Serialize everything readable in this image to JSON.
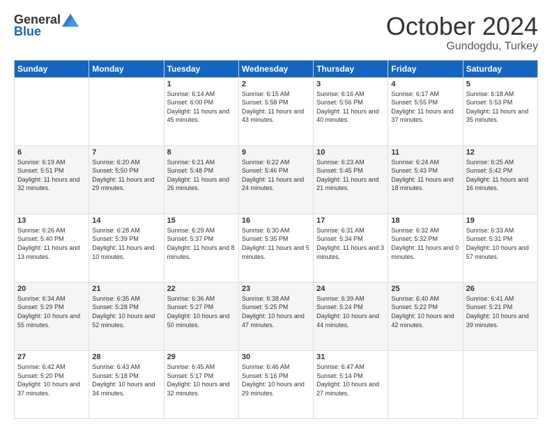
{
  "header": {
    "logo_general": "General",
    "logo_blue": "Blue",
    "month": "October 2024",
    "location": "Gundogdu, Turkey"
  },
  "weekdays": [
    "Sunday",
    "Monday",
    "Tuesday",
    "Wednesday",
    "Thursday",
    "Friday",
    "Saturday"
  ],
  "weeks": [
    [
      {
        "day": "",
        "sunrise": "",
        "sunset": "",
        "daylight": ""
      },
      {
        "day": "",
        "sunrise": "",
        "sunset": "",
        "daylight": ""
      },
      {
        "day": "1",
        "sunrise": "Sunrise: 6:14 AM",
        "sunset": "Sunset: 6:00 PM",
        "daylight": "Daylight: 11 hours and 45 minutes."
      },
      {
        "day": "2",
        "sunrise": "Sunrise: 6:15 AM",
        "sunset": "Sunset: 5:58 PM",
        "daylight": "Daylight: 11 hours and 43 minutes."
      },
      {
        "day": "3",
        "sunrise": "Sunrise: 6:16 AM",
        "sunset": "Sunset: 5:56 PM",
        "daylight": "Daylight: 11 hours and 40 minutes."
      },
      {
        "day": "4",
        "sunrise": "Sunrise: 6:17 AM",
        "sunset": "Sunset: 5:55 PM",
        "daylight": "Daylight: 11 hours and 37 minutes."
      },
      {
        "day": "5",
        "sunrise": "Sunrise: 6:18 AM",
        "sunset": "Sunset: 5:53 PM",
        "daylight": "Daylight: 11 hours and 35 minutes."
      }
    ],
    [
      {
        "day": "6",
        "sunrise": "Sunrise: 6:19 AM",
        "sunset": "Sunset: 5:51 PM",
        "daylight": "Daylight: 11 hours and 32 minutes."
      },
      {
        "day": "7",
        "sunrise": "Sunrise: 6:20 AM",
        "sunset": "Sunset: 5:50 PM",
        "daylight": "Daylight: 11 hours and 29 minutes."
      },
      {
        "day": "8",
        "sunrise": "Sunrise: 6:21 AM",
        "sunset": "Sunset: 5:48 PM",
        "daylight": "Daylight: 11 hours and 26 minutes."
      },
      {
        "day": "9",
        "sunrise": "Sunrise: 6:22 AM",
        "sunset": "Sunset: 5:46 PM",
        "daylight": "Daylight: 11 hours and 24 minutes."
      },
      {
        "day": "10",
        "sunrise": "Sunrise: 6:23 AM",
        "sunset": "Sunset: 5:45 PM",
        "daylight": "Daylight: 11 hours and 21 minutes."
      },
      {
        "day": "11",
        "sunrise": "Sunrise: 6:24 AM",
        "sunset": "Sunset: 5:43 PM",
        "daylight": "Daylight: 11 hours and 18 minutes."
      },
      {
        "day": "12",
        "sunrise": "Sunrise: 6:25 AM",
        "sunset": "Sunset: 5:42 PM",
        "daylight": "Daylight: 11 hours and 16 minutes."
      }
    ],
    [
      {
        "day": "13",
        "sunrise": "Sunrise: 6:26 AM",
        "sunset": "Sunset: 5:40 PM",
        "daylight": "Daylight: 11 hours and 13 minutes."
      },
      {
        "day": "14",
        "sunrise": "Sunrise: 6:28 AM",
        "sunset": "Sunset: 5:39 PM",
        "daylight": "Daylight: 11 hours and 10 minutes."
      },
      {
        "day": "15",
        "sunrise": "Sunrise: 6:29 AM",
        "sunset": "Sunset: 5:37 PM",
        "daylight": "Daylight: 11 hours and 8 minutes."
      },
      {
        "day": "16",
        "sunrise": "Sunrise: 6:30 AM",
        "sunset": "Sunset: 5:35 PM",
        "daylight": "Daylight: 11 hours and 5 minutes."
      },
      {
        "day": "17",
        "sunrise": "Sunrise: 6:31 AM",
        "sunset": "Sunset: 5:34 PM",
        "daylight": "Daylight: 11 hours and 3 minutes."
      },
      {
        "day": "18",
        "sunrise": "Sunrise: 6:32 AM",
        "sunset": "Sunset: 5:32 PM",
        "daylight": "Daylight: 11 hours and 0 minutes."
      },
      {
        "day": "19",
        "sunrise": "Sunrise: 6:33 AM",
        "sunset": "Sunset: 5:31 PM",
        "daylight": "Daylight: 10 hours and 57 minutes."
      }
    ],
    [
      {
        "day": "20",
        "sunrise": "Sunrise: 6:34 AM",
        "sunset": "Sunset: 5:29 PM",
        "daylight": "Daylight: 10 hours and 55 minutes."
      },
      {
        "day": "21",
        "sunrise": "Sunrise: 6:35 AM",
        "sunset": "Sunset: 5:28 PM",
        "daylight": "Daylight: 10 hours and 52 minutes."
      },
      {
        "day": "22",
        "sunrise": "Sunrise: 6:36 AM",
        "sunset": "Sunset: 5:27 PM",
        "daylight": "Daylight: 10 hours and 50 minutes."
      },
      {
        "day": "23",
        "sunrise": "Sunrise: 6:38 AM",
        "sunset": "Sunset: 5:25 PM",
        "daylight": "Daylight: 10 hours and 47 minutes."
      },
      {
        "day": "24",
        "sunrise": "Sunrise: 6:39 AM",
        "sunset": "Sunset: 5:24 PM",
        "daylight": "Daylight: 10 hours and 44 minutes."
      },
      {
        "day": "25",
        "sunrise": "Sunrise: 6:40 AM",
        "sunset": "Sunset: 5:22 PM",
        "daylight": "Daylight: 10 hours and 42 minutes."
      },
      {
        "day": "26",
        "sunrise": "Sunrise: 6:41 AM",
        "sunset": "Sunset: 5:21 PM",
        "daylight": "Daylight: 10 hours and 39 minutes."
      }
    ],
    [
      {
        "day": "27",
        "sunrise": "Sunrise: 6:42 AM",
        "sunset": "Sunset: 5:20 PM",
        "daylight": "Daylight: 10 hours and 37 minutes."
      },
      {
        "day": "28",
        "sunrise": "Sunrise: 6:43 AM",
        "sunset": "Sunset: 5:18 PM",
        "daylight": "Daylight: 10 hours and 34 minutes."
      },
      {
        "day": "29",
        "sunrise": "Sunrise: 6:45 AM",
        "sunset": "Sunset: 5:17 PM",
        "daylight": "Daylight: 10 hours and 32 minutes."
      },
      {
        "day": "30",
        "sunrise": "Sunrise: 6:46 AM",
        "sunset": "Sunset: 5:16 PM",
        "daylight": "Daylight: 10 hours and 29 minutes."
      },
      {
        "day": "31",
        "sunrise": "Sunrise: 6:47 AM",
        "sunset": "Sunset: 5:14 PM",
        "daylight": "Daylight: 10 hours and 27 minutes."
      },
      {
        "day": "",
        "sunrise": "",
        "sunset": "",
        "daylight": ""
      },
      {
        "day": "",
        "sunrise": "",
        "sunset": "",
        "daylight": ""
      }
    ]
  ]
}
